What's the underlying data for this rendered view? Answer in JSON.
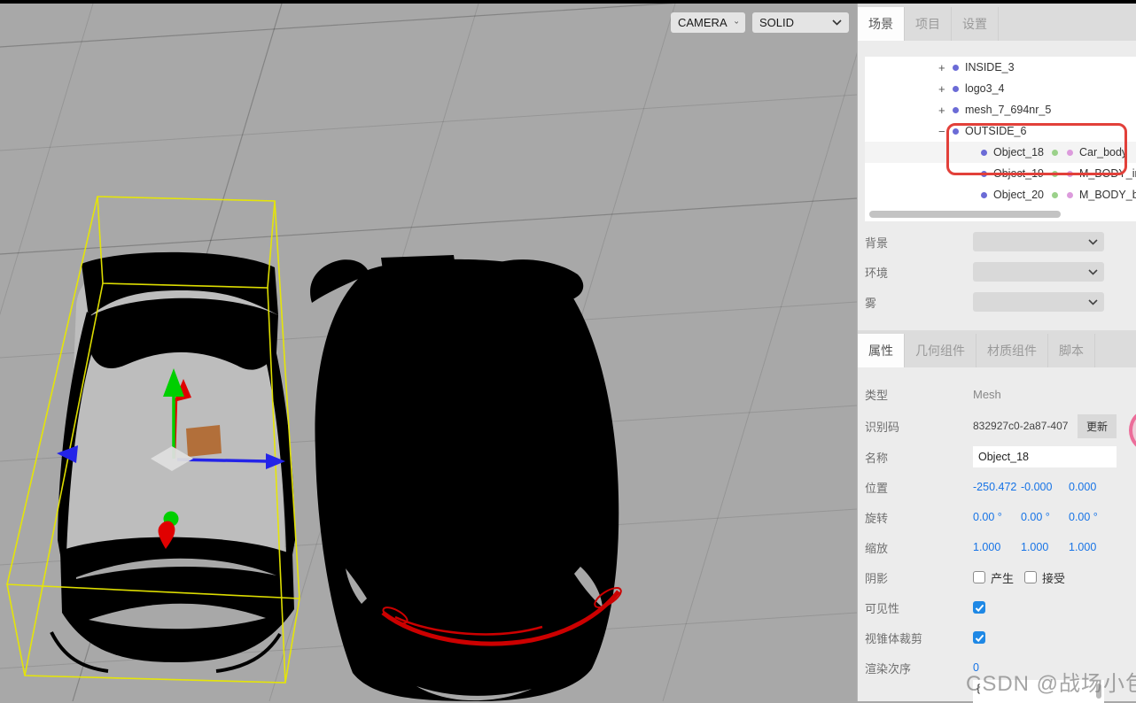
{
  "viewport": {
    "camera_select": {
      "value": "CAMERA"
    },
    "shading_select": {
      "value": "SOLID"
    },
    "colors": {
      "background": "#a8a8a8",
      "selection_box_yellow": "#e8e800",
      "gizmo_x_red": "#e00000",
      "gizmo_y_green": "#00cf00",
      "gizmo_z_blue": "#2424e8",
      "tail_light_red": "#cc0000",
      "crate_brown": "#b26f3a",
      "car_interior_gray": "#bdbdbd",
      "car_silhouette": "#000000"
    }
  },
  "panel": {
    "tabs": {
      "scene": "场景",
      "project": "项目",
      "settings": "设置"
    },
    "outliner": {
      "rows": [
        {
          "expander": "+",
          "name": "INSIDE_3",
          "material": ""
        },
        {
          "expander": "+",
          "name": "logo3_4",
          "material": ""
        },
        {
          "expander": "+",
          "name": "mesh_7_694nr_5",
          "material": ""
        },
        {
          "expander": "−",
          "name": "OUTSIDE_6",
          "material": ""
        },
        {
          "expander": "",
          "name": "Object_18",
          "material": "Car_body"
        },
        {
          "expander": "",
          "name": "Object_19",
          "material": "M_BODY_inside"
        },
        {
          "expander": "",
          "name": "Object_20",
          "material": "M_BODY_black"
        }
      ]
    },
    "scene_props": {
      "background": "背景",
      "environment": "环境",
      "fog": "雾"
    },
    "object_tabs": {
      "properties": "属性",
      "geometry": "几何组件",
      "material": "材质组件",
      "script": "脚本"
    },
    "object_props": {
      "type_label": "类型",
      "type_value": "Mesh",
      "uuid_label": "识别码",
      "uuid_value": "832927c0-2a87-407",
      "uuid_button": "更新",
      "name_label": "名称",
      "name_value": "Object_18",
      "position_label": "位置",
      "position": {
        "x": "-250.472",
        "y": "-0.000",
        "z": "0.000"
      },
      "rotation_label": "旋转",
      "rotation": {
        "x": "0.00 °",
        "y": "0.00 °",
        "z": "0.00 °"
      },
      "scale_label": "缩放",
      "scale": {
        "x": "1.000",
        "y": "1.000",
        "z": "1.000"
      },
      "shadow_label": "阴影",
      "shadow_cast_label": "产生",
      "shadow_receive_label": "接受",
      "shadow_cast_checked": false,
      "shadow_receive_checked": false,
      "visible_label": "可见性",
      "visible_checked": true,
      "frustum_label": "视锥体裁剪",
      "frustum_checked": true,
      "render_order_label": "渲染次序",
      "render_order_value": "0",
      "user_data_value": "{"
    },
    "annotation_color": "#e2403a"
  },
  "watermark": "CSDN @战场小包"
}
